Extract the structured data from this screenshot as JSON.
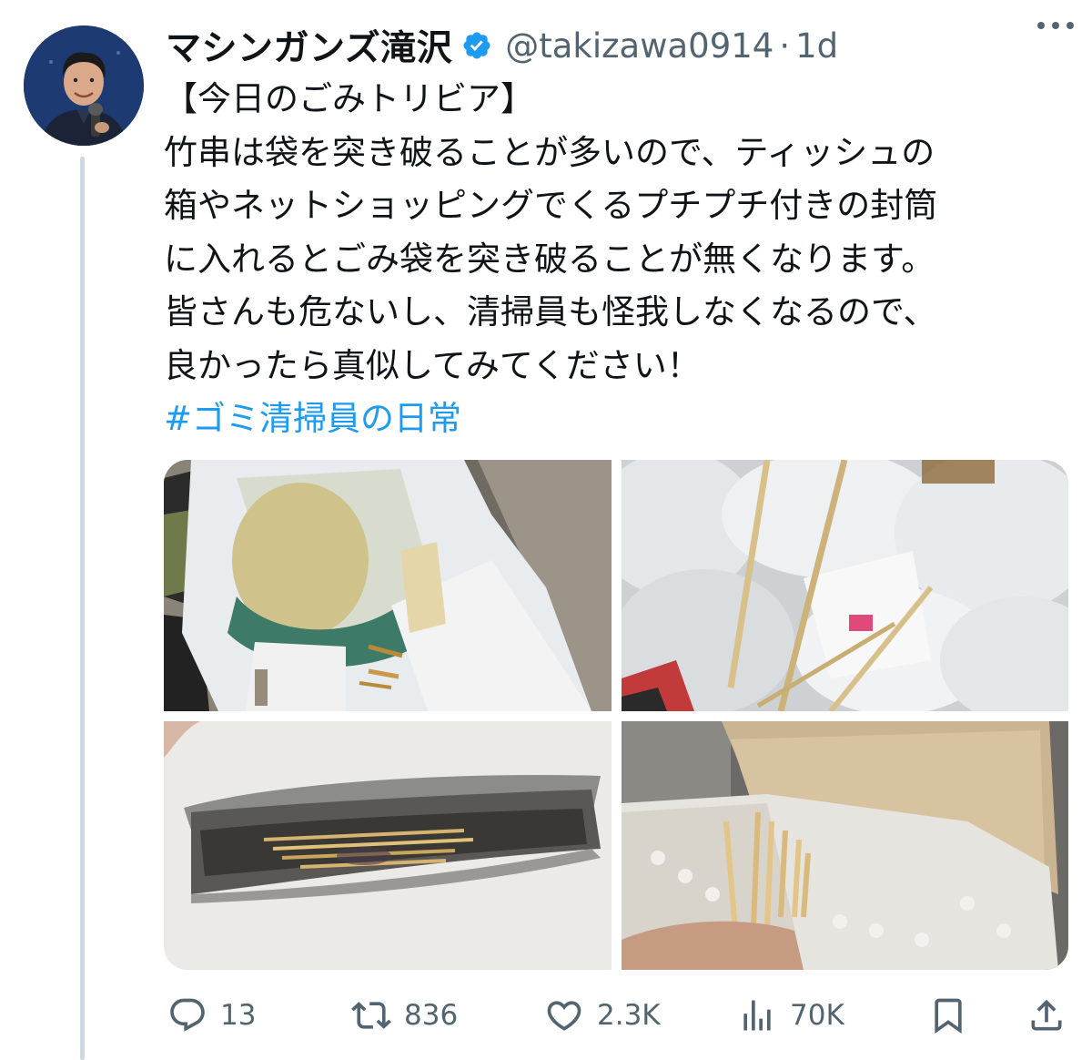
{
  "author": {
    "display_name": "マシンガンズ滝沢",
    "handle": "@takizawa0914",
    "separator": "·",
    "timestamp": "1d",
    "verified_icon": "verified-badge-icon",
    "verified_color": "#1d9bf0"
  },
  "tweet": {
    "lines": [
      "【今日のごみトリビア】",
      "竹串は袋を突き破ることが多いので、ティッシュの",
      "箱やネットショッピングでくるプチプチ付きの封筒",
      "に入れるとごみ袋を突き破ることが無くなります。",
      "皆さんも危ないし、清掃員も怪我しなくなるので、",
      "良かったら真似してみてください！"
    ],
    "hashtag": "#ゴミ清掃員の日常",
    "hashtag_color": "#1d9bf0"
  },
  "actions": {
    "reply_count": "13",
    "retweet_count": "836",
    "like_count": "2.3K",
    "view_count": "70K",
    "icon_color": "#536471"
  },
  "media": {
    "count": 4
  }
}
